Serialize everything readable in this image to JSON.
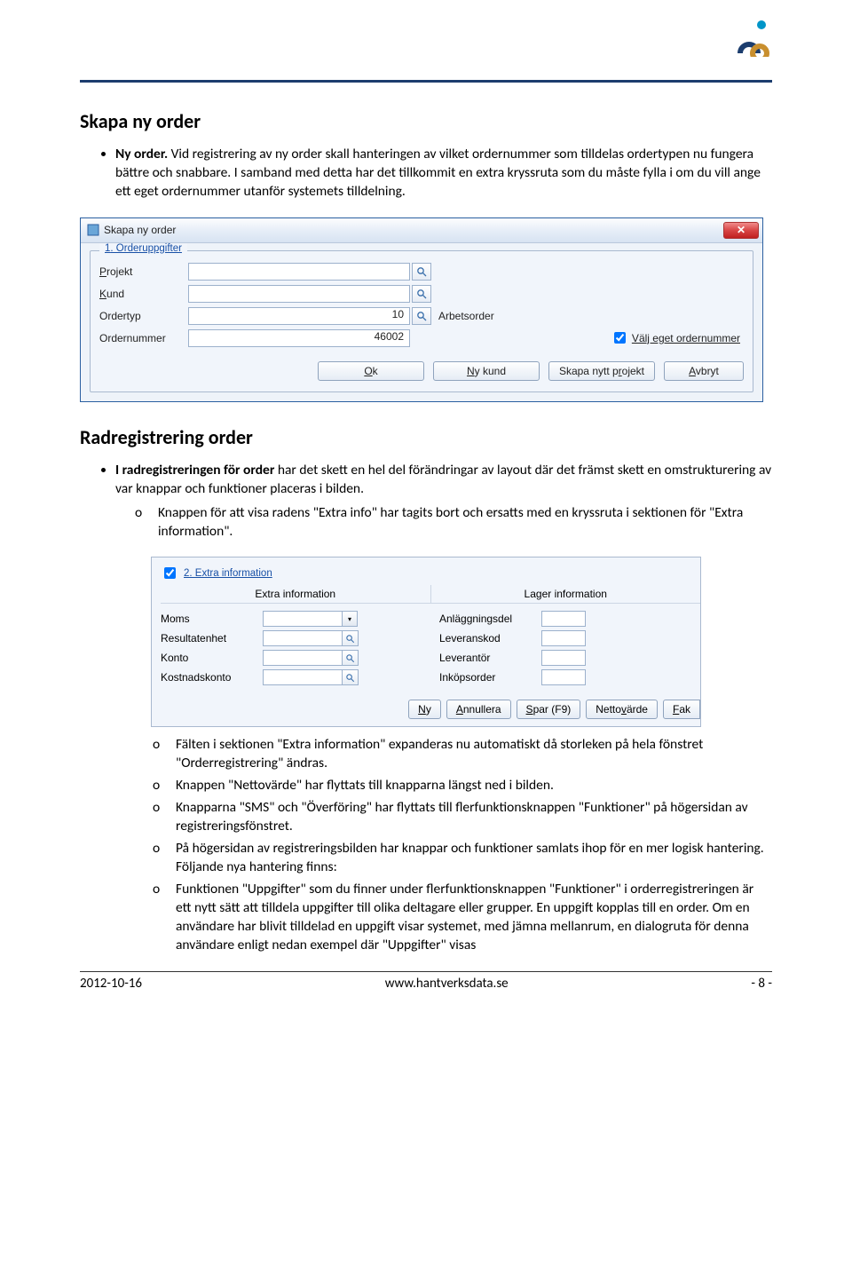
{
  "header": {},
  "section1": {
    "heading": "Skapa ny order",
    "bullet_bold": "Ny order.",
    "bullet_rest": " Vid registrering av ny order skall hanteringen av vilket ordernummer som tilldelas ordertypen nu fungera bättre och snabbare. I samband med detta har det tillkommit en extra kryssruta som du måste fylla i om du vill ange ett eget ordernummer utanför systemets tilldelning."
  },
  "dialog1": {
    "title": "Skapa ny order",
    "group_tab_prefix": "1",
    "group_tab_rest": ". Orderuppgifter",
    "rows": {
      "projekt_label_ul": "P",
      "projekt_label_rest": "rojekt",
      "kund_label_ul": "K",
      "kund_label_rest": "und",
      "ordertyp_label": "Ordertyp",
      "ordertyp_value": "10",
      "ordertyp_after": "Arbetsorder",
      "ordernr_label": "Ordernummer",
      "ordernr_value": "46002"
    },
    "checkbox_label_ul": "V",
    "checkbox_label_rest": "älj eget ordernummer",
    "buttons": {
      "ok_ul": "O",
      "ok_rest": "k",
      "nykund_ul": "N",
      "nykund_rest": "y kund",
      "nyttproj_pre": "Skapa nytt p",
      "nyttproj_ul": "r",
      "nyttproj_rest": "ojekt",
      "avbryt_ul": "A",
      "avbryt_rest": "vbryt"
    }
  },
  "section2": {
    "heading": "Radregistrering order",
    "bullet_bold": "I radregistreringen för order",
    "bullet_rest": " har det skett en hel del förändringar av layout där det främst skett en omstrukturering av var knappar och funktioner placeras i bilden.",
    "sub1": "Knappen för att visa radens \"Extra info\" har tagits bort och ersatts med en kryssruta i sektionen för \"Extra information\"."
  },
  "dialog2": {
    "tab_prefix": "2",
    "tab_rest": ". Extra information",
    "header_left": "Extra information",
    "header_right": "Lager information",
    "left_rows": [
      "Moms",
      "Resultatenhet",
      "Konto",
      "Kostnadskonto"
    ],
    "right_rows": [
      "Anläggningsdel",
      "Leveranskod",
      "Leverantör",
      "Inköpsorder"
    ],
    "buttons": {
      "ny_ul": "N",
      "ny_rest": "y",
      "ann_ul": "A",
      "ann_rest": "nnullera",
      "spar_ul": "S",
      "spar_rest": "par (F9)",
      "netto_pre": "Netto",
      "netto_ul": "v",
      "netto_rest": "ärde",
      "fak_ul": "F",
      "fak_rest": "ak"
    }
  },
  "subpoints": {
    "p1": "Fälten i sektionen \"Extra information\" expanderas nu automatiskt då storleken på hela fönstret \"Orderregistrering\" ändras.",
    "p2": "Knappen \"Nettovärde\" har flyttats till knapparna längst ned i bilden.",
    "p3": "Knapparna \"SMS\" och \"Överföring\" har flyttats till flerfunktionsknappen \"Funktioner\" på högersidan av registreringsfönstret.",
    "p4": "På högersidan av registreringsbilden har knappar och funktioner samlats ihop för en mer logisk hantering. Följande nya hantering finns:",
    "p5": "Funktionen \"Uppgifter\" som du finner under flerfunktionsknappen \"Funktioner\" i orderregistreringen är ett nytt sätt att tilldela uppgifter till olika deltagare eller grupper. En uppgift kopplas till en order. Om en användare har blivit tilldelad en uppgift visar systemet, med jämna mellanrum, en dialogruta för denna användare enligt nedan exempel där \"Uppgifter\" visas"
  },
  "footer": {
    "left": "2012-10-16",
    "center": "www.hantverksdata.se",
    "right": "- 8 -"
  }
}
